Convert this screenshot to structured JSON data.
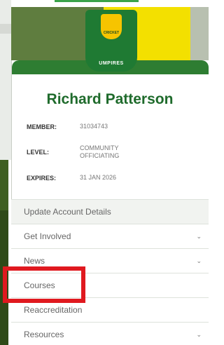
{
  "logo": {
    "brand": "CRICKET",
    "sub": "UMPIRES"
  },
  "profile": {
    "name": "Richard Patterson",
    "member_label": "MEMBER:",
    "member_value": "31034743",
    "level_label": "LEVEL:",
    "level_value_line1": "COMMUNITY",
    "level_value_line2": "OFFICIATING",
    "expires_label": "EXPIRES:",
    "expires_value": "31 JAN 2026"
  },
  "menu": {
    "items": [
      {
        "label": "Update Account Details",
        "has_chevron": false
      },
      {
        "label": "Get Involved",
        "has_chevron": true
      },
      {
        "label": "News",
        "has_chevron": true
      },
      {
        "label": "Courses",
        "has_chevron": false
      },
      {
        "label": "Reaccreditation",
        "has_chevron": false
      },
      {
        "label": "Resources",
        "has_chevron": true
      }
    ]
  },
  "colors": {
    "accent": "#2e7d32",
    "highlight": "#e0191f",
    "logo_yellow": "#f6c400"
  }
}
